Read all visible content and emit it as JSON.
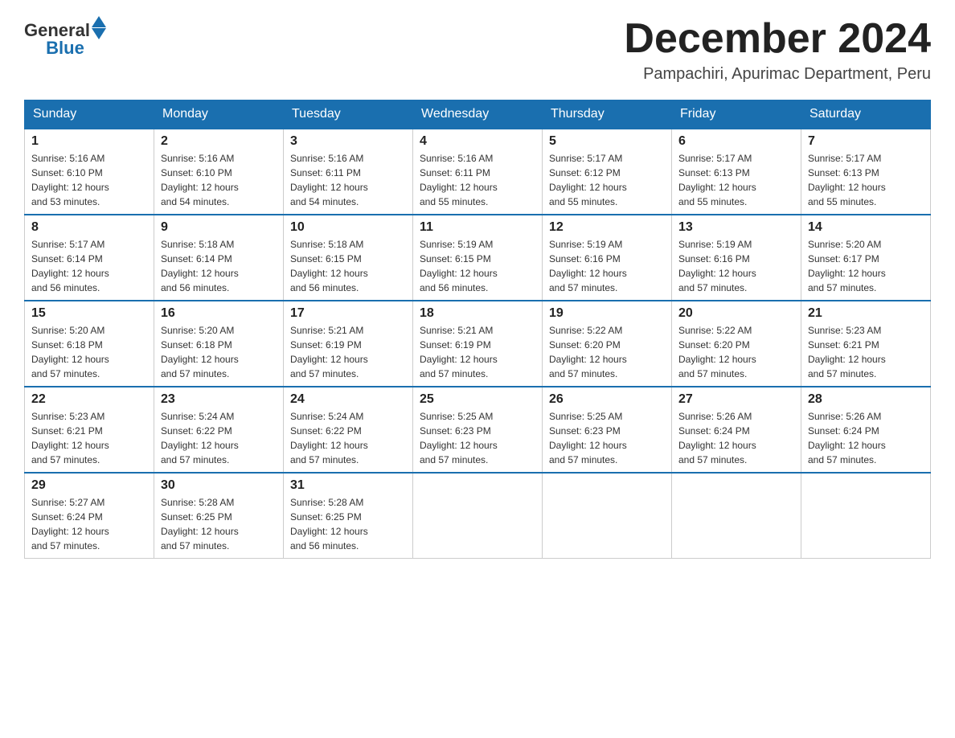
{
  "header": {
    "logo_general": "General",
    "logo_blue": "Blue",
    "month_title": "December 2024",
    "location": "Pampachiri, Apurimac Department, Peru"
  },
  "days_of_week": [
    "Sunday",
    "Monday",
    "Tuesday",
    "Wednesday",
    "Thursday",
    "Friday",
    "Saturday"
  ],
  "weeks": [
    [
      {
        "day": "1",
        "sunrise": "5:16 AM",
        "sunset": "6:10 PM",
        "daylight": "12 hours and 53 minutes."
      },
      {
        "day": "2",
        "sunrise": "5:16 AM",
        "sunset": "6:10 PM",
        "daylight": "12 hours and 54 minutes."
      },
      {
        "day": "3",
        "sunrise": "5:16 AM",
        "sunset": "6:11 PM",
        "daylight": "12 hours and 54 minutes."
      },
      {
        "day": "4",
        "sunrise": "5:16 AM",
        "sunset": "6:11 PM",
        "daylight": "12 hours and 55 minutes."
      },
      {
        "day": "5",
        "sunrise": "5:17 AM",
        "sunset": "6:12 PM",
        "daylight": "12 hours and 55 minutes."
      },
      {
        "day": "6",
        "sunrise": "5:17 AM",
        "sunset": "6:13 PM",
        "daylight": "12 hours and 55 minutes."
      },
      {
        "day": "7",
        "sunrise": "5:17 AM",
        "sunset": "6:13 PM",
        "daylight": "12 hours and 55 minutes."
      }
    ],
    [
      {
        "day": "8",
        "sunrise": "5:17 AM",
        "sunset": "6:14 PM",
        "daylight": "12 hours and 56 minutes."
      },
      {
        "day": "9",
        "sunrise": "5:18 AM",
        "sunset": "6:14 PM",
        "daylight": "12 hours and 56 minutes."
      },
      {
        "day": "10",
        "sunrise": "5:18 AM",
        "sunset": "6:15 PM",
        "daylight": "12 hours and 56 minutes."
      },
      {
        "day": "11",
        "sunrise": "5:19 AM",
        "sunset": "6:15 PM",
        "daylight": "12 hours and 56 minutes."
      },
      {
        "day": "12",
        "sunrise": "5:19 AM",
        "sunset": "6:16 PM",
        "daylight": "12 hours and 57 minutes."
      },
      {
        "day": "13",
        "sunrise": "5:19 AM",
        "sunset": "6:16 PM",
        "daylight": "12 hours and 57 minutes."
      },
      {
        "day": "14",
        "sunrise": "5:20 AM",
        "sunset": "6:17 PM",
        "daylight": "12 hours and 57 minutes."
      }
    ],
    [
      {
        "day": "15",
        "sunrise": "5:20 AM",
        "sunset": "6:18 PM",
        "daylight": "12 hours and 57 minutes."
      },
      {
        "day": "16",
        "sunrise": "5:20 AM",
        "sunset": "6:18 PM",
        "daylight": "12 hours and 57 minutes."
      },
      {
        "day": "17",
        "sunrise": "5:21 AM",
        "sunset": "6:19 PM",
        "daylight": "12 hours and 57 minutes."
      },
      {
        "day": "18",
        "sunrise": "5:21 AM",
        "sunset": "6:19 PM",
        "daylight": "12 hours and 57 minutes."
      },
      {
        "day": "19",
        "sunrise": "5:22 AM",
        "sunset": "6:20 PM",
        "daylight": "12 hours and 57 minutes."
      },
      {
        "day": "20",
        "sunrise": "5:22 AM",
        "sunset": "6:20 PM",
        "daylight": "12 hours and 57 minutes."
      },
      {
        "day": "21",
        "sunrise": "5:23 AM",
        "sunset": "6:21 PM",
        "daylight": "12 hours and 57 minutes."
      }
    ],
    [
      {
        "day": "22",
        "sunrise": "5:23 AM",
        "sunset": "6:21 PM",
        "daylight": "12 hours and 57 minutes."
      },
      {
        "day": "23",
        "sunrise": "5:24 AM",
        "sunset": "6:22 PM",
        "daylight": "12 hours and 57 minutes."
      },
      {
        "day": "24",
        "sunrise": "5:24 AM",
        "sunset": "6:22 PM",
        "daylight": "12 hours and 57 minutes."
      },
      {
        "day": "25",
        "sunrise": "5:25 AM",
        "sunset": "6:23 PM",
        "daylight": "12 hours and 57 minutes."
      },
      {
        "day": "26",
        "sunrise": "5:25 AM",
        "sunset": "6:23 PM",
        "daylight": "12 hours and 57 minutes."
      },
      {
        "day": "27",
        "sunrise": "5:26 AM",
        "sunset": "6:24 PM",
        "daylight": "12 hours and 57 minutes."
      },
      {
        "day": "28",
        "sunrise": "5:26 AM",
        "sunset": "6:24 PM",
        "daylight": "12 hours and 57 minutes."
      }
    ],
    [
      {
        "day": "29",
        "sunrise": "5:27 AM",
        "sunset": "6:24 PM",
        "daylight": "12 hours and 57 minutes."
      },
      {
        "day": "30",
        "sunrise": "5:28 AM",
        "sunset": "6:25 PM",
        "daylight": "12 hours and 57 minutes."
      },
      {
        "day": "31",
        "sunrise": "5:28 AM",
        "sunset": "6:25 PM",
        "daylight": "12 hours and 56 minutes."
      },
      null,
      null,
      null,
      null
    ]
  ],
  "labels": {
    "sunrise": "Sunrise:",
    "sunset": "Sunset:",
    "daylight": "Daylight:"
  }
}
